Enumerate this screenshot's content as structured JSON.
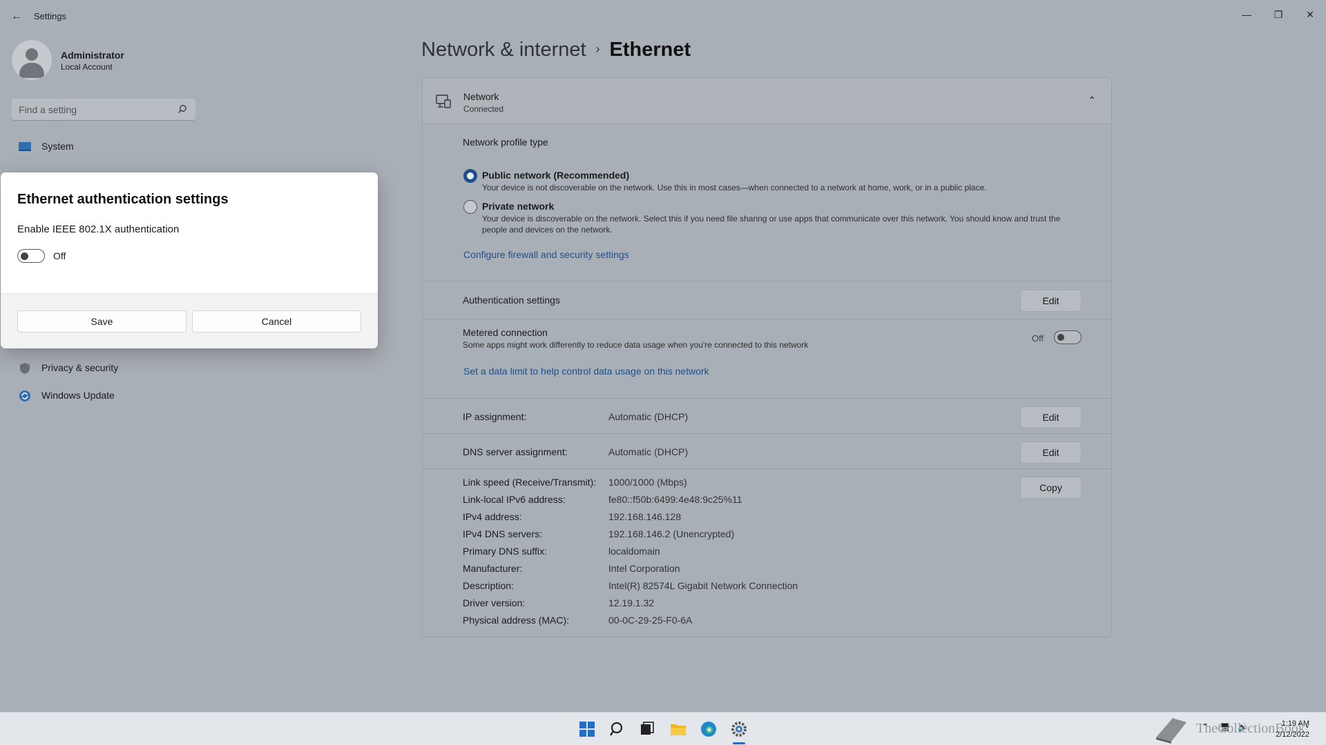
{
  "window": {
    "title": "Settings",
    "controls": {
      "minimize": "—",
      "restore": "❐",
      "close": "✕"
    }
  },
  "user": {
    "name": "Administrator",
    "account": "Local Account"
  },
  "search": {
    "placeholder": "Find a setting",
    "value": ""
  },
  "sidebar": {
    "items": [
      {
        "label": "System",
        "icon": "system-icon"
      },
      {
        "label": "Privacy & security",
        "icon": "shield-icon"
      },
      {
        "label": "Windows Update",
        "icon": "windows-update-icon"
      }
    ]
  },
  "breadcrumb": {
    "parent": "Network & internet",
    "current": "Ethernet"
  },
  "network_card": {
    "title": "Network",
    "status": "Connected"
  },
  "profile": {
    "heading": "Network profile type",
    "public_label": "Public network (Recommended)",
    "public_desc": "Your device is not discoverable on the network. Use this in most cases—when connected to a network at home, work, or in a public place.",
    "private_label": "Private network",
    "private_desc": "Your device is discoverable on the network. Select this if you need file sharing or use apps that communicate over this network. You should know and trust the people and devices on the network.",
    "selected": "public",
    "firewall_link": "Configure firewall and security settings"
  },
  "auth": {
    "label": "Authentication settings",
    "edit": "Edit"
  },
  "metered": {
    "label": "Metered connection",
    "desc": "Some apps might work differently to reduce data usage when you're connected to this network",
    "state": "Off",
    "data_limit_link": "Set a data limit to help control data usage on this network"
  },
  "ip": {
    "label": "IP assignment:",
    "value": "Automatic (DHCP)",
    "edit": "Edit"
  },
  "dns": {
    "label": "DNS server assignment:",
    "value": "Automatic (DHCP)",
    "edit": "Edit"
  },
  "properties": {
    "copy": "Copy",
    "rows": [
      {
        "key": "Link speed (Receive/Transmit):",
        "value": "1000/1000 (Mbps)"
      },
      {
        "key": "Link-local IPv6 address:",
        "value": "fe80::f50b:6499:4e48:9c25%11"
      },
      {
        "key": "IPv4 address:",
        "value": "192.168.146.128"
      },
      {
        "key": "IPv4 DNS servers:",
        "value": "192.168.146.2 (Unencrypted)"
      },
      {
        "key": "Primary DNS suffix:",
        "value": "localdomain"
      },
      {
        "key": "Manufacturer:",
        "value": "Intel Corporation"
      },
      {
        "key": "Description:",
        "value": "Intel(R) 82574L Gigabit Network Connection"
      },
      {
        "key": "Driver version:",
        "value": "12.19.1.32"
      },
      {
        "key": "Physical address (MAC):",
        "value": "00-0C-29-25-F0-6A"
      }
    ]
  },
  "dialog": {
    "title": "Ethernet authentication settings",
    "toggle_label": "Enable IEEE 802.1X authentication",
    "toggle_state": "Off",
    "save": "Save",
    "cancel": "Cancel"
  },
  "taskbar": {
    "time": "1:19 AM",
    "date": "2/12/2022",
    "watermark": "TheCollectionBook"
  },
  "colors": {
    "accent": "#1f4f8a",
    "overlay": "#a9afb6",
    "dialog_bg": "#ffffff"
  }
}
